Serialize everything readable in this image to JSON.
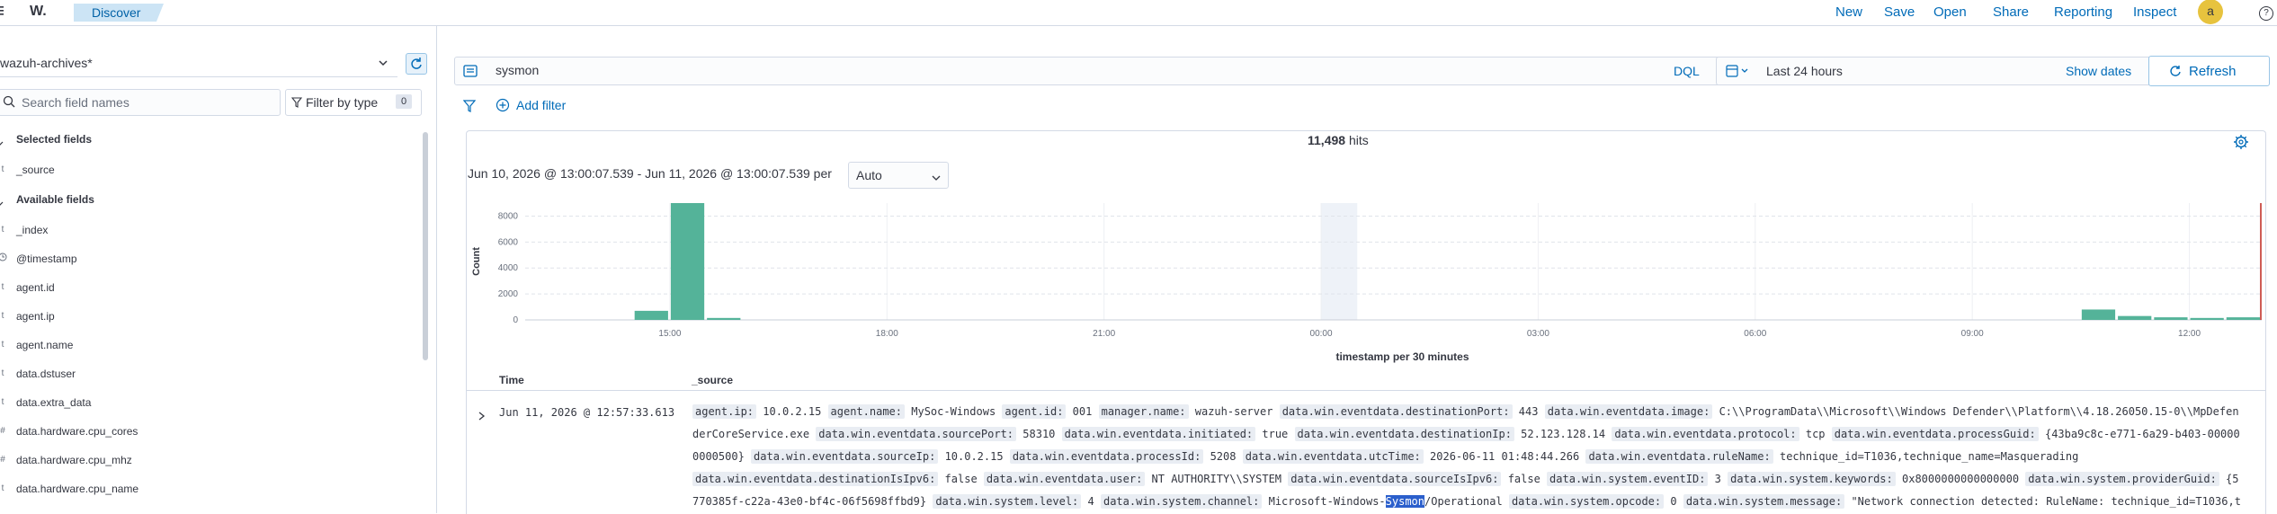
{
  "nav": {
    "logo": "W.",
    "breadcrumb": "Discover",
    "actions": [
      "New",
      "Save",
      "Open",
      "Share",
      "Reporting",
      "Inspect"
    ],
    "avatar": "a"
  },
  "sidebar": {
    "index_pattern": "wazuh-archives*",
    "search_placeholder": "Search field names",
    "filter_by_type": "Filter by type",
    "filter_count": "0",
    "selected_header": "Selected fields",
    "selected": [
      {
        "type": "t",
        "name": "_source"
      }
    ],
    "available_header": "Available fields",
    "available": [
      {
        "type": "t",
        "name": "_index"
      },
      {
        "type": "clock",
        "name": "@timestamp"
      },
      {
        "type": "t",
        "name": "agent.id"
      },
      {
        "type": "t",
        "name": "agent.ip"
      },
      {
        "type": "t",
        "name": "agent.name"
      },
      {
        "type": "t",
        "name": "data.dstuser"
      },
      {
        "type": "t",
        "name": "data.extra_data"
      },
      {
        "type": "#",
        "name": "data.hardware.cpu_cores"
      },
      {
        "type": "#",
        "name": "data.hardware.cpu_mhz"
      },
      {
        "type": "t",
        "name": "data.hardware.cpu_name"
      }
    ]
  },
  "query": {
    "value": "sysmon",
    "language": "DQL",
    "time_range": "Last 24 hours",
    "show_dates": "Show dates",
    "refresh": "Refresh",
    "add_filter": "Add filter"
  },
  "hits": {
    "count": "11,498",
    "label": "hits"
  },
  "interval": {
    "range": "Jun 10, 2026 @ 13:00:07.539 - Jun 11, 2026 @ 13:00:07.539 per",
    "value": "Auto"
  },
  "chart_data": {
    "type": "bar",
    "ylabel": "Count",
    "xlabel": "timestamp per 30 minutes",
    "ylim": [
      0,
      9000
    ],
    "yticks": [
      "0",
      "2000",
      "4000",
      "6000",
      "8000"
    ],
    "xticks": [
      "15:00",
      "18:00",
      "21:00",
      "00:00",
      "03:00",
      "06:00",
      "09:00",
      "12:00"
    ],
    "bars": [
      {
        "x": "14:30",
        "value": 700
      },
      {
        "x": "15:00",
        "value": 9000
      },
      {
        "x": "15:30",
        "value": 150
      },
      {
        "x": "10:30",
        "value": 800
      },
      {
        "x": "11:00",
        "value": 300
      },
      {
        "x": "11:30",
        "value": 200
      },
      {
        "x": "12:00",
        "value": 150
      },
      {
        "x": "12:30",
        "value": 200
      }
    ],
    "colors": {
      "bar": "#54b399",
      "now_line": "#bd271e"
    }
  },
  "table": {
    "col_time": "Time",
    "col_source": "_source",
    "row": {
      "time": "Jun 11, 2026 @ 12:57:33.613",
      "lines": [
        [
          [
            "agent.ip:",
            "10.0.2.15"
          ],
          [
            "agent.name:",
            "MySoc-Windows"
          ],
          [
            "agent.id:",
            "001"
          ],
          [
            "manager.name:",
            "wazuh-server"
          ],
          [
            "data.win.eventdata.destinationPort:",
            "443"
          ],
          [
            "data.win.eventdata.image:",
            "C:\\\\ProgramData\\\\Microsoft\\\\Windows Defender\\\\Platform\\\\4.18.26050.15-0\\\\MpDefen"
          ]
        ],
        [
          [
            "",
            "derCoreService.exe"
          ],
          [
            "data.win.eventdata.sourcePort:",
            "58310"
          ],
          [
            "data.win.eventdata.initiated:",
            "true"
          ],
          [
            "data.win.eventdata.destinationIp:",
            "52.123.128.14"
          ],
          [
            "data.win.eventdata.protocol:",
            "tcp"
          ],
          [
            "data.win.eventdata.processGuid:",
            "{43ba9c8c-e771-6a29-b403-00000"
          ]
        ],
        [
          [
            "",
            "0000500}"
          ],
          [
            "data.win.eventdata.sourceIp:",
            "10.0.2.15"
          ],
          [
            "data.win.eventdata.processId:",
            "5208"
          ],
          [
            "data.win.eventdata.utcTime:",
            "2026-06-11 01:48:44.266"
          ],
          [
            "data.win.eventdata.ruleName:",
            "technique_id=T1036,technique_name=Masquerading"
          ]
        ],
        [
          [
            "data.win.eventdata.destinationIsIpv6:",
            "false"
          ],
          [
            "data.win.eventdata.user:",
            "NT AUTHORITY\\\\SYSTEM"
          ],
          [
            "data.win.eventdata.sourceIsIpv6:",
            "false"
          ],
          [
            "data.win.system.eventID:",
            "3"
          ],
          [
            "data.win.system.keywords:",
            "0x8000000000000000"
          ],
          [
            "data.win.system.providerGuid:",
            "{5"
          ]
        ],
        [
          [
            "",
            "770385f-c22a-43e0-bf4c-06f5698ffbd9}"
          ],
          [
            "data.win.system.level:",
            "4"
          ],
          [
            "data.win.system.channel:",
            "Microsoft-Windows-|Sysmon|/Operational"
          ],
          [
            "data.win.system.opcode:",
            "0"
          ],
          [
            "data.win.system.message:",
            "\"Network connection detected: RuleName: technique_id=T1036,t"
          ]
        ]
      ]
    }
  }
}
